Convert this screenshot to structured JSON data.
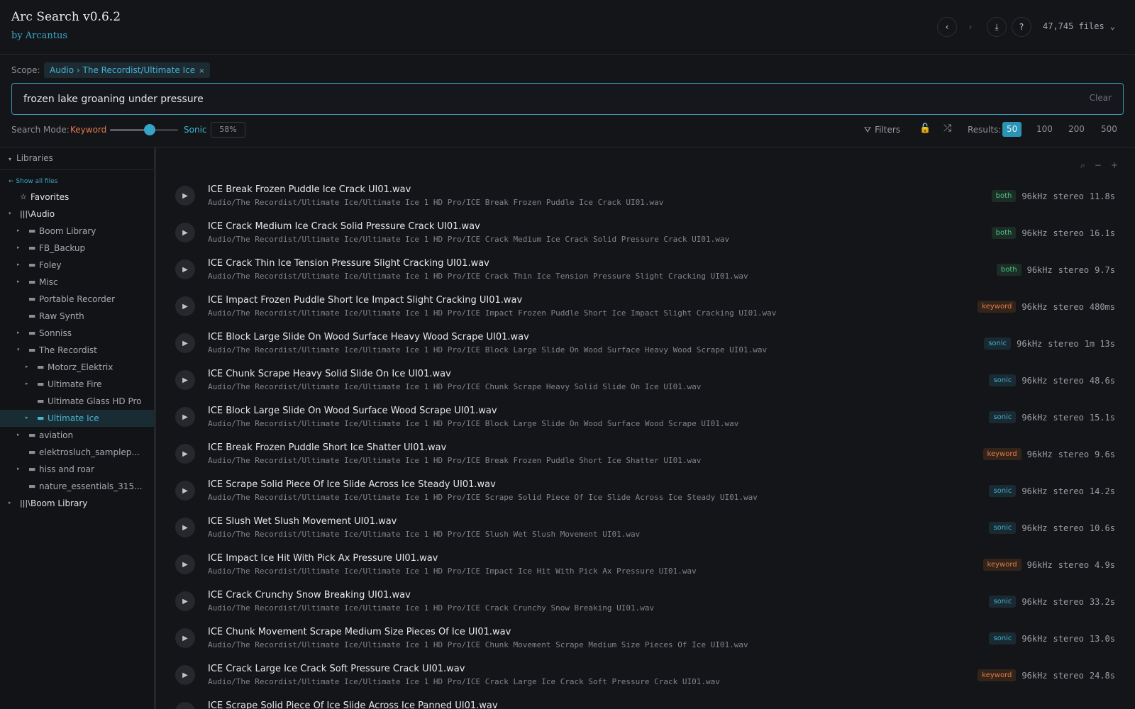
{
  "header": {
    "title": "Arc Search v0.6.2",
    "subtitle": "by Arcantus",
    "back_icon": "‹",
    "forward_icon": "›",
    "download_icon": "⤓",
    "help_icon": "?",
    "file_count": "47,745 files",
    "file_count_chevron": "⌄"
  },
  "scope": {
    "label": "Scope:",
    "chip": "Audio › The Recordist/Ultimate Ice",
    "chip_remove": "×"
  },
  "search": {
    "value": "frozen lake groaning under pressure",
    "clear_label": "Clear"
  },
  "mode": {
    "label": "Search Mode:",
    "keyword_label": "Keyword",
    "sonic_label": "Sonic",
    "percent": "58%",
    "slider_fraction": 0.58
  },
  "toolbar": {
    "filters_icon": "⛛",
    "filters_label": "Filters",
    "lock_icon": "🔓",
    "shuffle_icon": "⤮",
    "results_label": "Results:",
    "result_options": [
      "50",
      "100",
      "200",
      "500"
    ],
    "active_option": "50"
  },
  "sidebar": {
    "header": "Libraries",
    "header_caret": "▾",
    "show_all": "← Show all files",
    "tree": [
      {
        "label": "Favorites",
        "icon": "☆",
        "caret": "",
        "root": true
      },
      {
        "label": "Audio",
        "icon": "|||\\",
        "caret": "▾",
        "root": true
      },
      {
        "label": "Boom Library",
        "icon": "▬",
        "caret": "▸"
      },
      {
        "label": "FB_Backup",
        "icon": "▬",
        "caret": "▸"
      },
      {
        "label": "Foley",
        "icon": "▬",
        "caret": "▸"
      },
      {
        "label": "Misc",
        "icon": "▬",
        "caret": "▸"
      },
      {
        "label": "Portable Recorder",
        "icon": "▬",
        "caret": ""
      },
      {
        "label": "Raw Synth",
        "icon": "▬",
        "caret": ""
      },
      {
        "label": "Sonniss",
        "icon": "▬",
        "caret": "▸"
      },
      {
        "label": "The Recordist",
        "icon": "▬",
        "caret": "▾"
      },
      {
        "label": "Motorz_Elektrix",
        "icon": "▬",
        "caret": "▸"
      },
      {
        "label": "Ultimate Fire",
        "icon": "▬",
        "caret": "▸"
      },
      {
        "label": "Ultimate Glass HD Pro",
        "icon": "▬",
        "caret": ""
      },
      {
        "label": "Ultimate Ice",
        "icon": "▬",
        "caret": "▸",
        "selected": true
      },
      {
        "label": "aviation",
        "icon": "▬",
        "caret": "▸"
      },
      {
        "label": "elektrosluch_samplep...",
        "icon": "▬",
        "caret": ""
      },
      {
        "label": "hiss and roar",
        "icon": "▬",
        "caret": "▸"
      },
      {
        "label": "nature_essentials_315...",
        "icon": "▬",
        "caret": ""
      },
      {
        "label": "Boom Library",
        "icon": "|||\\",
        "caret": "▸",
        "root": true
      }
    ]
  },
  "main": {
    "search_icon": "⌕",
    "zoom_out": "−",
    "zoom_in": "+",
    "play_icon": "▶",
    "results": [
      {
        "name": "ICE Break Frozen Puddle Ice Crack UI01.wav",
        "path": "Audio/The Recordist/Ultimate Ice/Ultimate Ice 1 HD Pro/ICE Break Frozen Puddle Ice Crack UI01.wav",
        "match": "both",
        "rate": "96kHz",
        "channels": "stereo",
        "duration": "11.8s"
      },
      {
        "name": "ICE Crack Medium Ice Crack Solid Pressure Crack UI01.wav",
        "path": "Audio/The Recordist/Ultimate Ice/Ultimate Ice 1 HD Pro/ICE Crack Medium Ice Crack Solid Pressure Crack UI01.wav",
        "match": "both",
        "rate": "96kHz",
        "channels": "stereo",
        "duration": "16.1s"
      },
      {
        "name": "ICE Crack Thin Ice Tension Pressure Slight Cracking UI01.wav",
        "path": "Audio/The Recordist/Ultimate Ice/Ultimate Ice 1 HD Pro/ICE Crack Thin Ice Tension Pressure Slight Cracking UI01.wav",
        "match": "both",
        "rate": "96kHz",
        "channels": "stereo",
        "duration": "9.7s"
      },
      {
        "name": "ICE Impact Frozen Puddle Short Ice Impact Slight Cracking UI01.wav",
        "path": "Audio/The Recordist/Ultimate Ice/Ultimate Ice 1 HD Pro/ICE Impact Frozen Puddle Short Ice Impact Slight Cracking UI01.wav",
        "match": "keyword",
        "rate": "96kHz",
        "channels": "stereo",
        "duration": "480ms"
      },
      {
        "name": "ICE Block Large Slide On Wood Surface Heavy Wood Scrape UI01.wav",
        "path": "Audio/The Recordist/Ultimate Ice/Ultimate Ice 1 HD Pro/ICE Block Large Slide On Wood Surface Heavy Wood Scrape UI01.wav",
        "match": "sonic",
        "rate": "96kHz",
        "channels": "stereo",
        "duration": "1m 13s"
      },
      {
        "name": "ICE Chunk Scrape Heavy Solid Slide On Ice UI01.wav",
        "path": "Audio/The Recordist/Ultimate Ice/Ultimate Ice 1 HD Pro/ICE Chunk Scrape Heavy Solid Slide On Ice UI01.wav",
        "match": "sonic",
        "rate": "96kHz",
        "channels": "stereo",
        "duration": "48.6s"
      },
      {
        "name": "ICE Block Large Slide On Wood Surface Wood Scrape UI01.wav",
        "path": "Audio/The Recordist/Ultimate Ice/Ultimate Ice 1 HD Pro/ICE Block Large Slide On Wood Surface Wood Scrape UI01.wav",
        "match": "sonic",
        "rate": "96kHz",
        "channels": "stereo",
        "duration": "15.1s"
      },
      {
        "name": "ICE Break Frozen Puddle Short Ice Shatter UI01.wav",
        "path": "Audio/The Recordist/Ultimate Ice/Ultimate Ice 1 HD Pro/ICE Break Frozen Puddle Short Ice Shatter UI01.wav",
        "match": "keyword",
        "rate": "96kHz",
        "channels": "stereo",
        "duration": "9.6s"
      },
      {
        "name": "ICE Scrape Solid Piece Of Ice Slide Across Ice Steady UI01.wav",
        "path": "Audio/The Recordist/Ultimate Ice/Ultimate Ice 1 HD Pro/ICE Scrape Solid Piece Of Ice Slide Across Ice Steady UI01.wav",
        "match": "sonic",
        "rate": "96kHz",
        "channels": "stereo",
        "duration": "14.2s"
      },
      {
        "name": "ICE Slush Wet Slush Movement UI01.wav",
        "path": "Audio/The Recordist/Ultimate Ice/Ultimate Ice 1 HD Pro/ICE Slush Wet Slush Movement UI01.wav",
        "match": "sonic",
        "rate": "96kHz",
        "channels": "stereo",
        "duration": "10.6s"
      },
      {
        "name": "ICE Impact Ice Hit With Pick Ax Pressure UI01.wav",
        "path": "Audio/The Recordist/Ultimate Ice/Ultimate Ice 1 HD Pro/ICE Impact Ice Hit With Pick Ax Pressure UI01.wav",
        "match": "keyword",
        "rate": "96kHz",
        "channels": "stereo",
        "duration": "4.9s"
      },
      {
        "name": "ICE Crack Crunchy Snow Breaking UI01.wav",
        "path": "Audio/The Recordist/Ultimate Ice/Ultimate Ice 1 HD Pro/ICE Crack Crunchy Snow Breaking UI01.wav",
        "match": "sonic",
        "rate": "96kHz",
        "channels": "stereo",
        "duration": "33.2s"
      },
      {
        "name": "ICE Chunk Movement Scrape Medium Size Pieces Of Ice UI01.wav",
        "path": "Audio/The Recordist/Ultimate Ice/Ultimate Ice 1 HD Pro/ICE Chunk Movement Scrape Medium Size Pieces Of Ice UI01.wav",
        "match": "sonic",
        "rate": "96kHz",
        "channels": "stereo",
        "duration": "13.0s"
      },
      {
        "name": "ICE Crack Large Ice Crack Soft Pressure Crack UI01.wav",
        "path": "Audio/The Recordist/Ultimate Ice/Ultimate Ice 1 HD Pro/ICE Crack Large Ice Crack Soft Pressure Crack UI01.wav",
        "match": "keyword",
        "rate": "96kHz",
        "channels": "stereo",
        "duration": "24.8s"
      },
      {
        "name": "ICE Scrape Solid Piece Of Ice Slide Across Ice Panned UI01.wav",
        "path": "",
        "match": "",
        "rate": "",
        "channels": "",
        "duration": ""
      }
    ]
  }
}
